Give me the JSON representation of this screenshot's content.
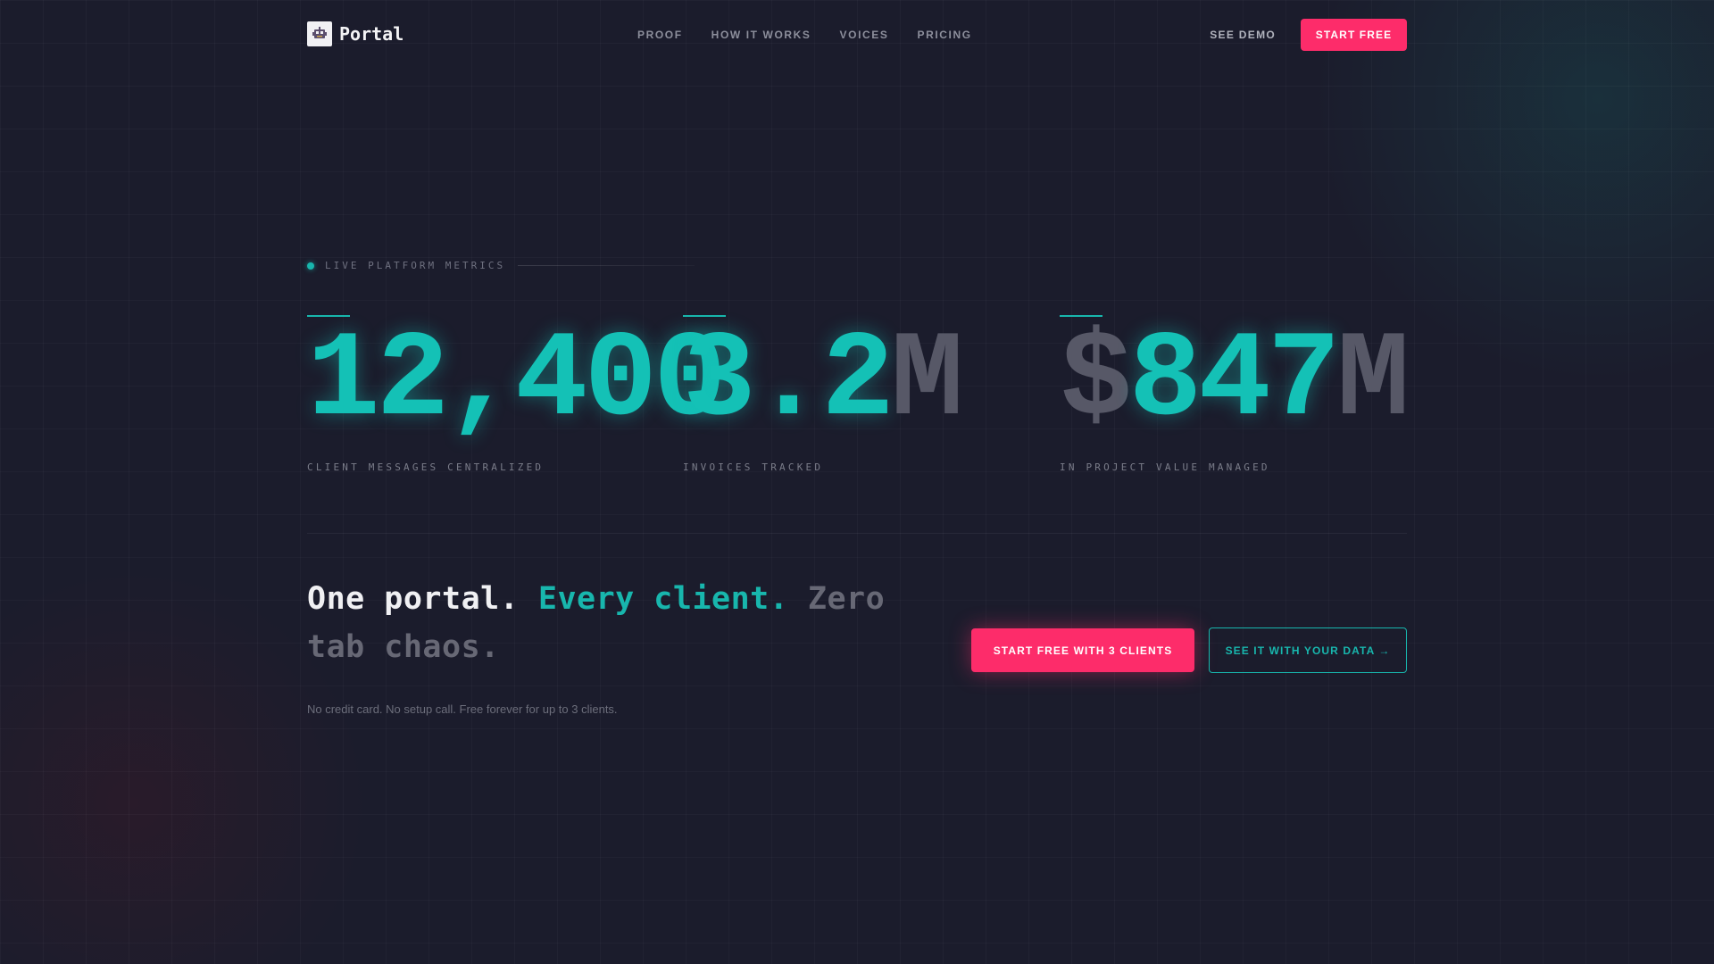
{
  "nav": {
    "brand": "Portal",
    "links": [
      "PROOF",
      "HOW IT WORKS",
      "VOICES",
      "PRICING"
    ],
    "see_demo": "SEE DEMO",
    "start_free": "START FREE"
  },
  "eyebrow": "LIVE PLATFORM METRICS",
  "stats": [
    {
      "value": "12,400",
      "dim_prefix": "",
      "dim_suffix": "",
      "label": "CLIENT MESSAGES CENTRALIZED"
    },
    {
      "value": "3.2",
      "dim_prefix": "",
      "dim_suffix": "M",
      "label": "INVOICES TRACKED"
    },
    {
      "value": "847",
      "dim_prefix": "$",
      "dim_suffix": "M",
      "label": "IN PROJECT VALUE MANAGED"
    }
  ],
  "headline": {
    "part1": "One portal.",
    "part2": "Every client.",
    "part3": "Zero tab chaos."
  },
  "subtext": "No credit card. No setup call. Free forever for up to 3 clients.",
  "cta": {
    "primary": "START FREE WITH 3 CLIENTS",
    "secondary": "SEE IT WITH YOUR DATA →"
  },
  "colors": {
    "background": "#1b1c2c",
    "accent_teal": "#18b6ad",
    "accent_pink": "#fd2c6a",
    "muted_digit": "#575867"
  },
  "icons": {
    "brand_logo": "portal-logo-icon",
    "live_indicator": "live-dot-icon"
  }
}
